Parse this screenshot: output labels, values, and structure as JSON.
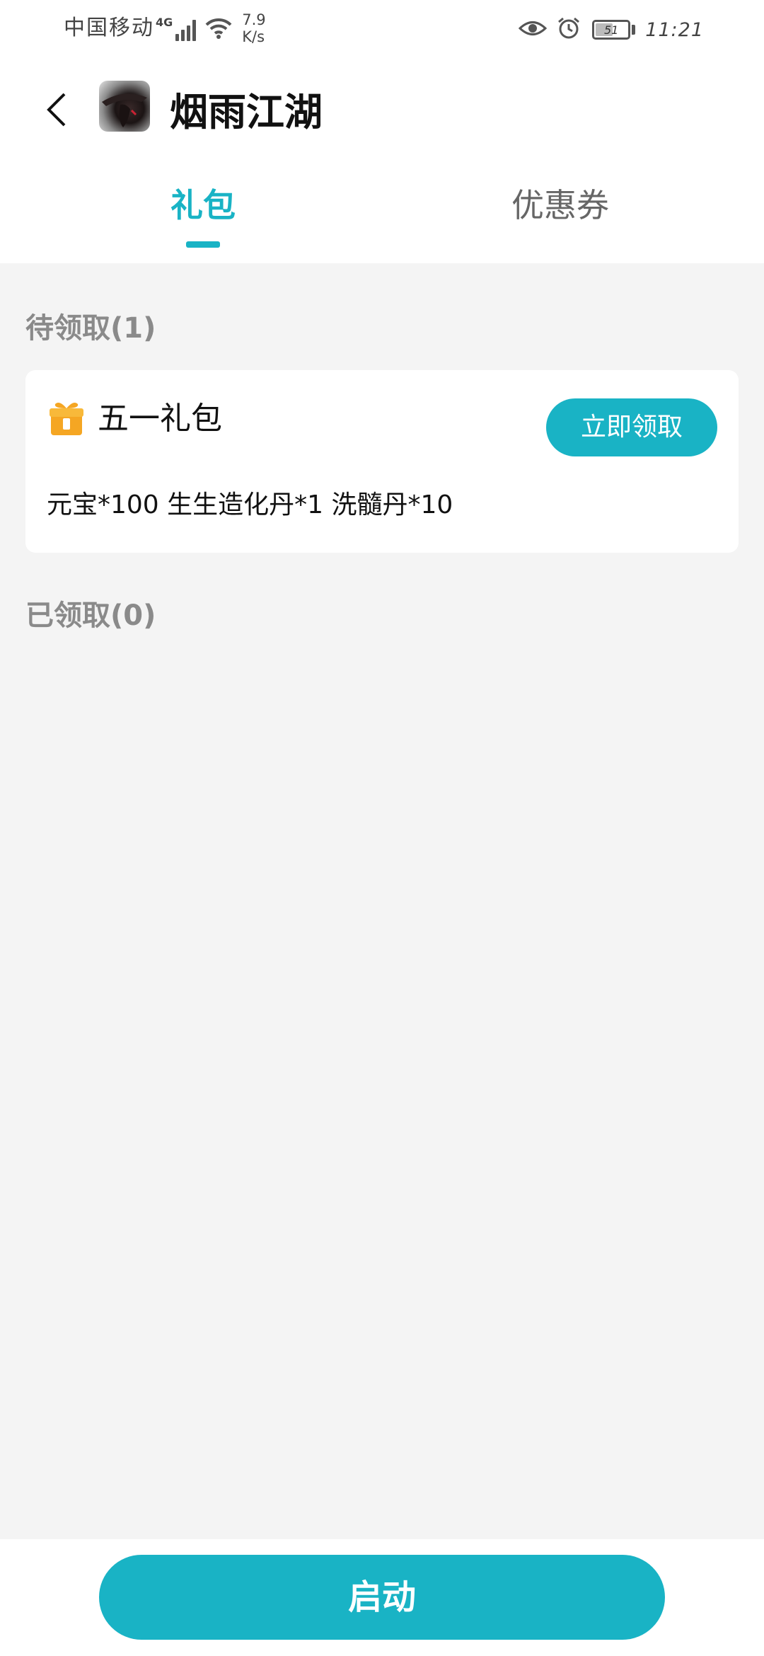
{
  "status_bar": {
    "carrier": "中国移动",
    "network_type": "4G",
    "speed_value": "7.9",
    "speed_unit": "K/s",
    "battery_level": "51",
    "time": "11:21"
  },
  "header": {
    "title": "烟雨江湖",
    "tabs": [
      {
        "label": "礼包",
        "active": true
      },
      {
        "label": "优惠券",
        "active": false
      }
    ]
  },
  "sections": {
    "pending_title": "待领取(1)",
    "received_title": "已领取(0)"
  },
  "gift_card": {
    "name": "五一礼包",
    "claim_label": "立即领取",
    "items": "元宝*100 生生造化丹*1 洗髓丹*10"
  },
  "bottom": {
    "launch_label": "启动"
  },
  "colors": {
    "accent": "#19b3c5",
    "background": "#f4f4f4",
    "card": "#ffffff",
    "section_title": "#8a8a8a",
    "gift_icon": "#f5a623"
  }
}
